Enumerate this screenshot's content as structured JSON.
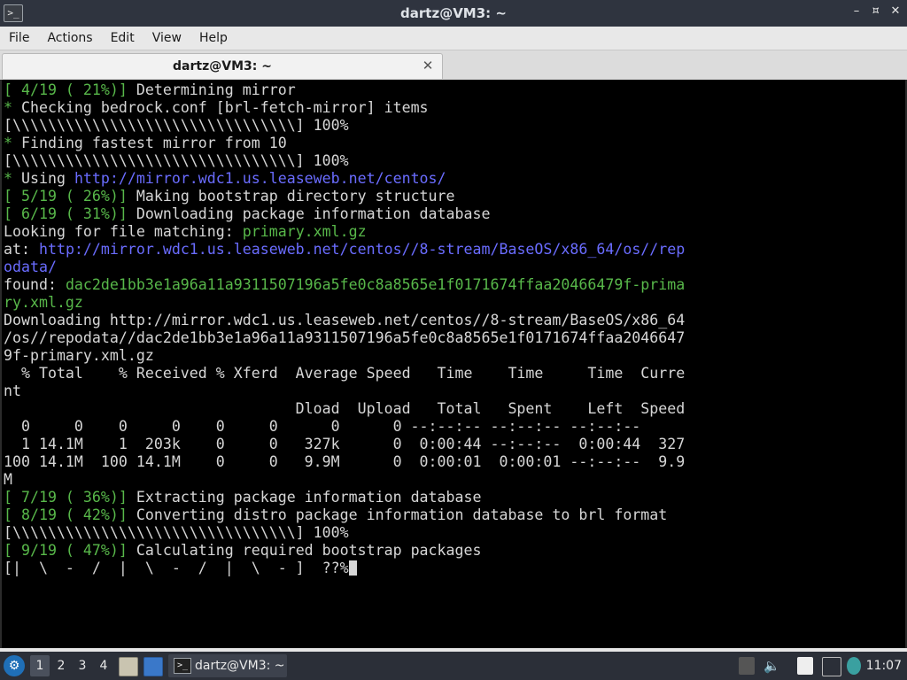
{
  "window": {
    "title": "dartz@VM3: ~",
    "app_icon": ">_",
    "controls": {
      "minimize": "–",
      "maximize": "⯏",
      "close": "✕"
    }
  },
  "menubar": {
    "items": [
      "File",
      "Actions",
      "Edit",
      "View",
      "Help"
    ]
  },
  "tabs": [
    {
      "label": "dartz@VM3: ~",
      "close": "✕"
    }
  ],
  "terminal": {
    "lines": [
      [
        {
          "t": "[ 4/19 ( 21%)]",
          "c": "g"
        },
        {
          "t": " Determining mirror"
        }
      ],
      [
        {
          "t": "*",
          "c": "g"
        },
        {
          "t": " Checking bedrock.conf [brl-fetch-mirror] items"
        }
      ],
      [
        {
          "t": "[\\\\\\\\\\\\\\\\\\\\\\\\\\\\\\\\\\\\\\\\\\\\\\\\\\\\\\\\\\\\\\\\] 100%"
        }
      ],
      [
        {
          "t": "*",
          "c": "g"
        },
        {
          "t": " Finding fastest mirror from 10"
        }
      ],
      [
        {
          "t": "[\\\\\\\\\\\\\\\\\\\\\\\\\\\\\\\\\\\\\\\\\\\\\\\\\\\\\\\\\\\\\\\\] 100%"
        }
      ],
      [
        {
          "t": "*",
          "c": "g"
        },
        {
          "t": " Using "
        },
        {
          "t": "http://mirror.wdc1.us.leaseweb.net/centos/",
          "c": "b"
        }
      ],
      [
        {
          "t": "[ 5/19 ( 26%)]",
          "c": "g"
        },
        {
          "t": " Making bootstrap directory structure"
        }
      ],
      [
        {
          "t": "[ 6/19 ( 31%)]",
          "c": "g"
        },
        {
          "t": " Downloading package information database"
        }
      ],
      [
        {
          "t": "Looking for file matching: "
        },
        {
          "t": "primary.xml.gz",
          "c": "g"
        }
      ],
      [
        {
          "t": "at: "
        },
        {
          "t": "http://mirror.wdc1.us.leaseweb.net/centos//8-stream/BaseOS/x86_64/os//rep",
          "c": "b"
        }
      ],
      [
        {
          "t": "odata/",
          "c": "b"
        }
      ],
      [
        {
          "t": "found: "
        },
        {
          "t": "dac2de1bb3e1a96a11a9311507196a5fe0c8a8565e1f0171674ffaa20466479f-prima",
          "c": "g"
        }
      ],
      [
        {
          "t": "ry.xml.gz",
          "c": "g"
        }
      ],
      [
        {
          "t": "Downloading http://mirror.wdc1.us.leaseweb.net/centos//8-stream/BaseOS/x86_64"
        }
      ],
      [
        {
          "t": "/os//repodata//dac2de1bb3e1a96a11a9311507196a5fe0c8a8565e1f0171674ffaa2046647"
        }
      ],
      [
        {
          "t": "9f-primary.xml.gz"
        }
      ],
      [
        {
          "t": "  % Total    % Received % Xferd  Average Speed   Time    Time     Time  Curre"
        }
      ],
      [
        {
          "t": "nt"
        }
      ],
      [
        {
          "t": "                                 Dload  Upload   Total   Spent    Left  Speed"
        }
      ],
      [
        {
          "t": "  0     0    0     0    0     0      0      0 --:--:-- --:--:-- --:--:--"
        }
      ],
      [
        {
          "t": "  1 14.1M    1  203k    0     0   327k      0  0:00:44 --:--:--  0:00:44  327"
        }
      ],
      [
        {
          "t": "100 14.1M  100 14.1M    0     0   9.9M      0  0:00:01  0:00:01 --:--:--  9.9"
        }
      ],
      [
        {
          "t": "M"
        }
      ],
      [
        {
          "t": "[ 7/19 ( 36%)]",
          "c": "g"
        },
        {
          "t": " Extracting package information database"
        }
      ],
      [
        {
          "t": "[ 8/19 ( 42%)]",
          "c": "g"
        },
        {
          "t": " Converting distro package information database to brl format"
        }
      ],
      [
        {
          "t": "[\\\\\\\\\\\\\\\\\\\\\\\\\\\\\\\\\\\\\\\\\\\\\\\\\\\\\\\\\\\\\\\\] 100%"
        }
      ],
      [
        {
          "t": "[ 9/19 ( 47%)]",
          "c": "g"
        },
        {
          "t": " Calculating required bootstrap packages"
        }
      ],
      [
        {
          "t": "[|  \\  -  /  |  \\  -  /  |  \\  - ]  ??%"
        }
      ]
    ]
  },
  "taskbar": {
    "start_icon": "⚙",
    "workspaces": [
      "1",
      "2",
      "3",
      "4"
    ],
    "active_workspace": "1",
    "task_label": "dartz@VM3: ~",
    "task_icon": ">_",
    "clock": "11:07"
  },
  "colors": {
    "green": "#58b84a",
    "blue_link": "#6a6cff",
    "terminal_bg": "#000000",
    "terminal_fg": "#d6d6d6"
  }
}
